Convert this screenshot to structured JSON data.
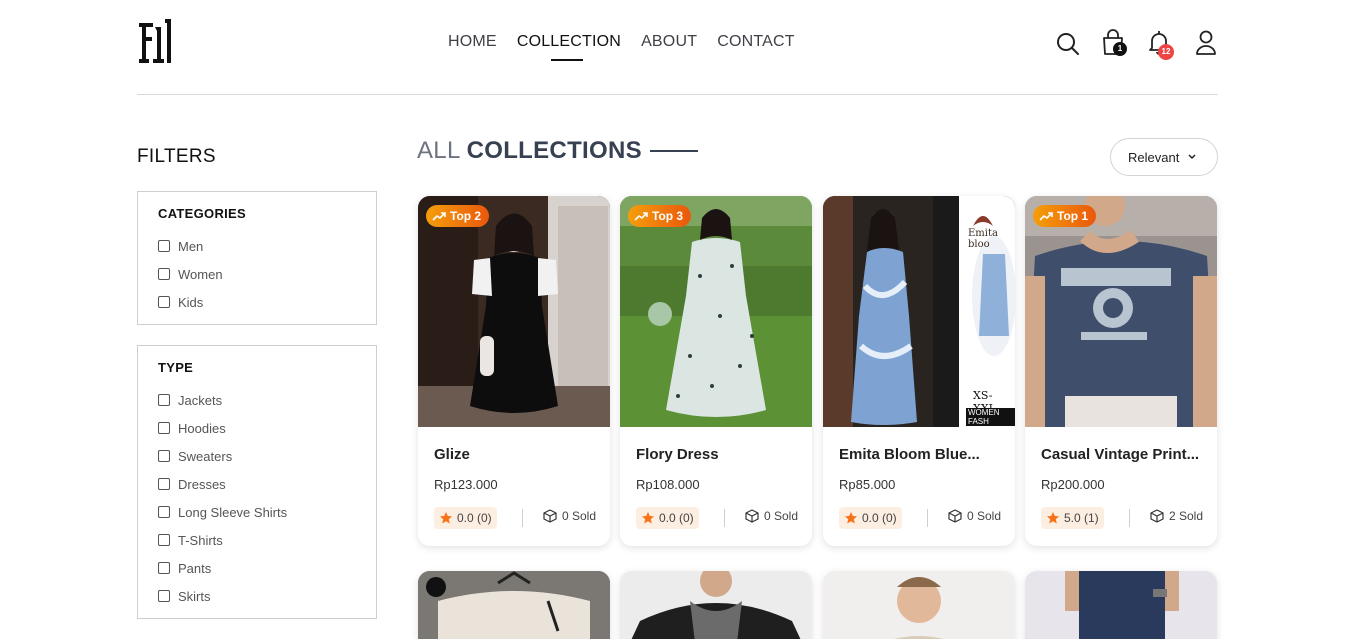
{
  "header": {
    "nav": [
      "HOME",
      "COLLECTION",
      "ABOUT",
      "CONTACT"
    ],
    "active_nav": "COLLECTION",
    "cart_count": "1",
    "notification_count": "12"
  },
  "filters": {
    "title": "FILTERS",
    "categories": {
      "heading": "CATEGORIES",
      "options": [
        "Men",
        "Women",
        "Kids"
      ]
    },
    "type": {
      "heading": "TYPE",
      "options": [
        "Jackets",
        "Hoodies",
        "Sweaters",
        "Dresses",
        "Long Sleeve Shirts",
        "T-Shirts",
        "Pants",
        "Skirts"
      ]
    }
  },
  "main": {
    "title_light": "ALL",
    "title_bold": "COLLECTIONS",
    "sort_label": "Relevant",
    "products": [
      {
        "tag": "Top 2",
        "name": "Glize",
        "price": "Rp123.000",
        "rating": "0.0 (0)",
        "sold": "0 Sold"
      },
      {
        "tag": "Top 3",
        "name": "Flory Dress",
        "price": "Rp108.000",
        "rating": "0.0 (0)",
        "sold": "0 Sold"
      },
      {
        "tag": "",
        "name": "Emita Bloom Blue...",
        "price": "Rp85.000",
        "rating": "0.0 (0)",
        "sold": "0 Sold",
        "image_text": [
          "Emita bloo",
          "XS-XXL",
          "WOMEN FASH"
        ]
      },
      {
        "tag": "Top 1",
        "name": "Casual Vintage Print...",
        "price": "Rp200.000",
        "rating": "5.0 (1)",
        "sold": "2 Sold"
      }
    ]
  },
  "colors": {
    "tag_gradient_start": "#f59e0b",
    "tag_gradient_end": "#ea580c",
    "rating_bg": "#fdeee2",
    "star": "#f97316",
    "badge_red": "#ef4444"
  }
}
